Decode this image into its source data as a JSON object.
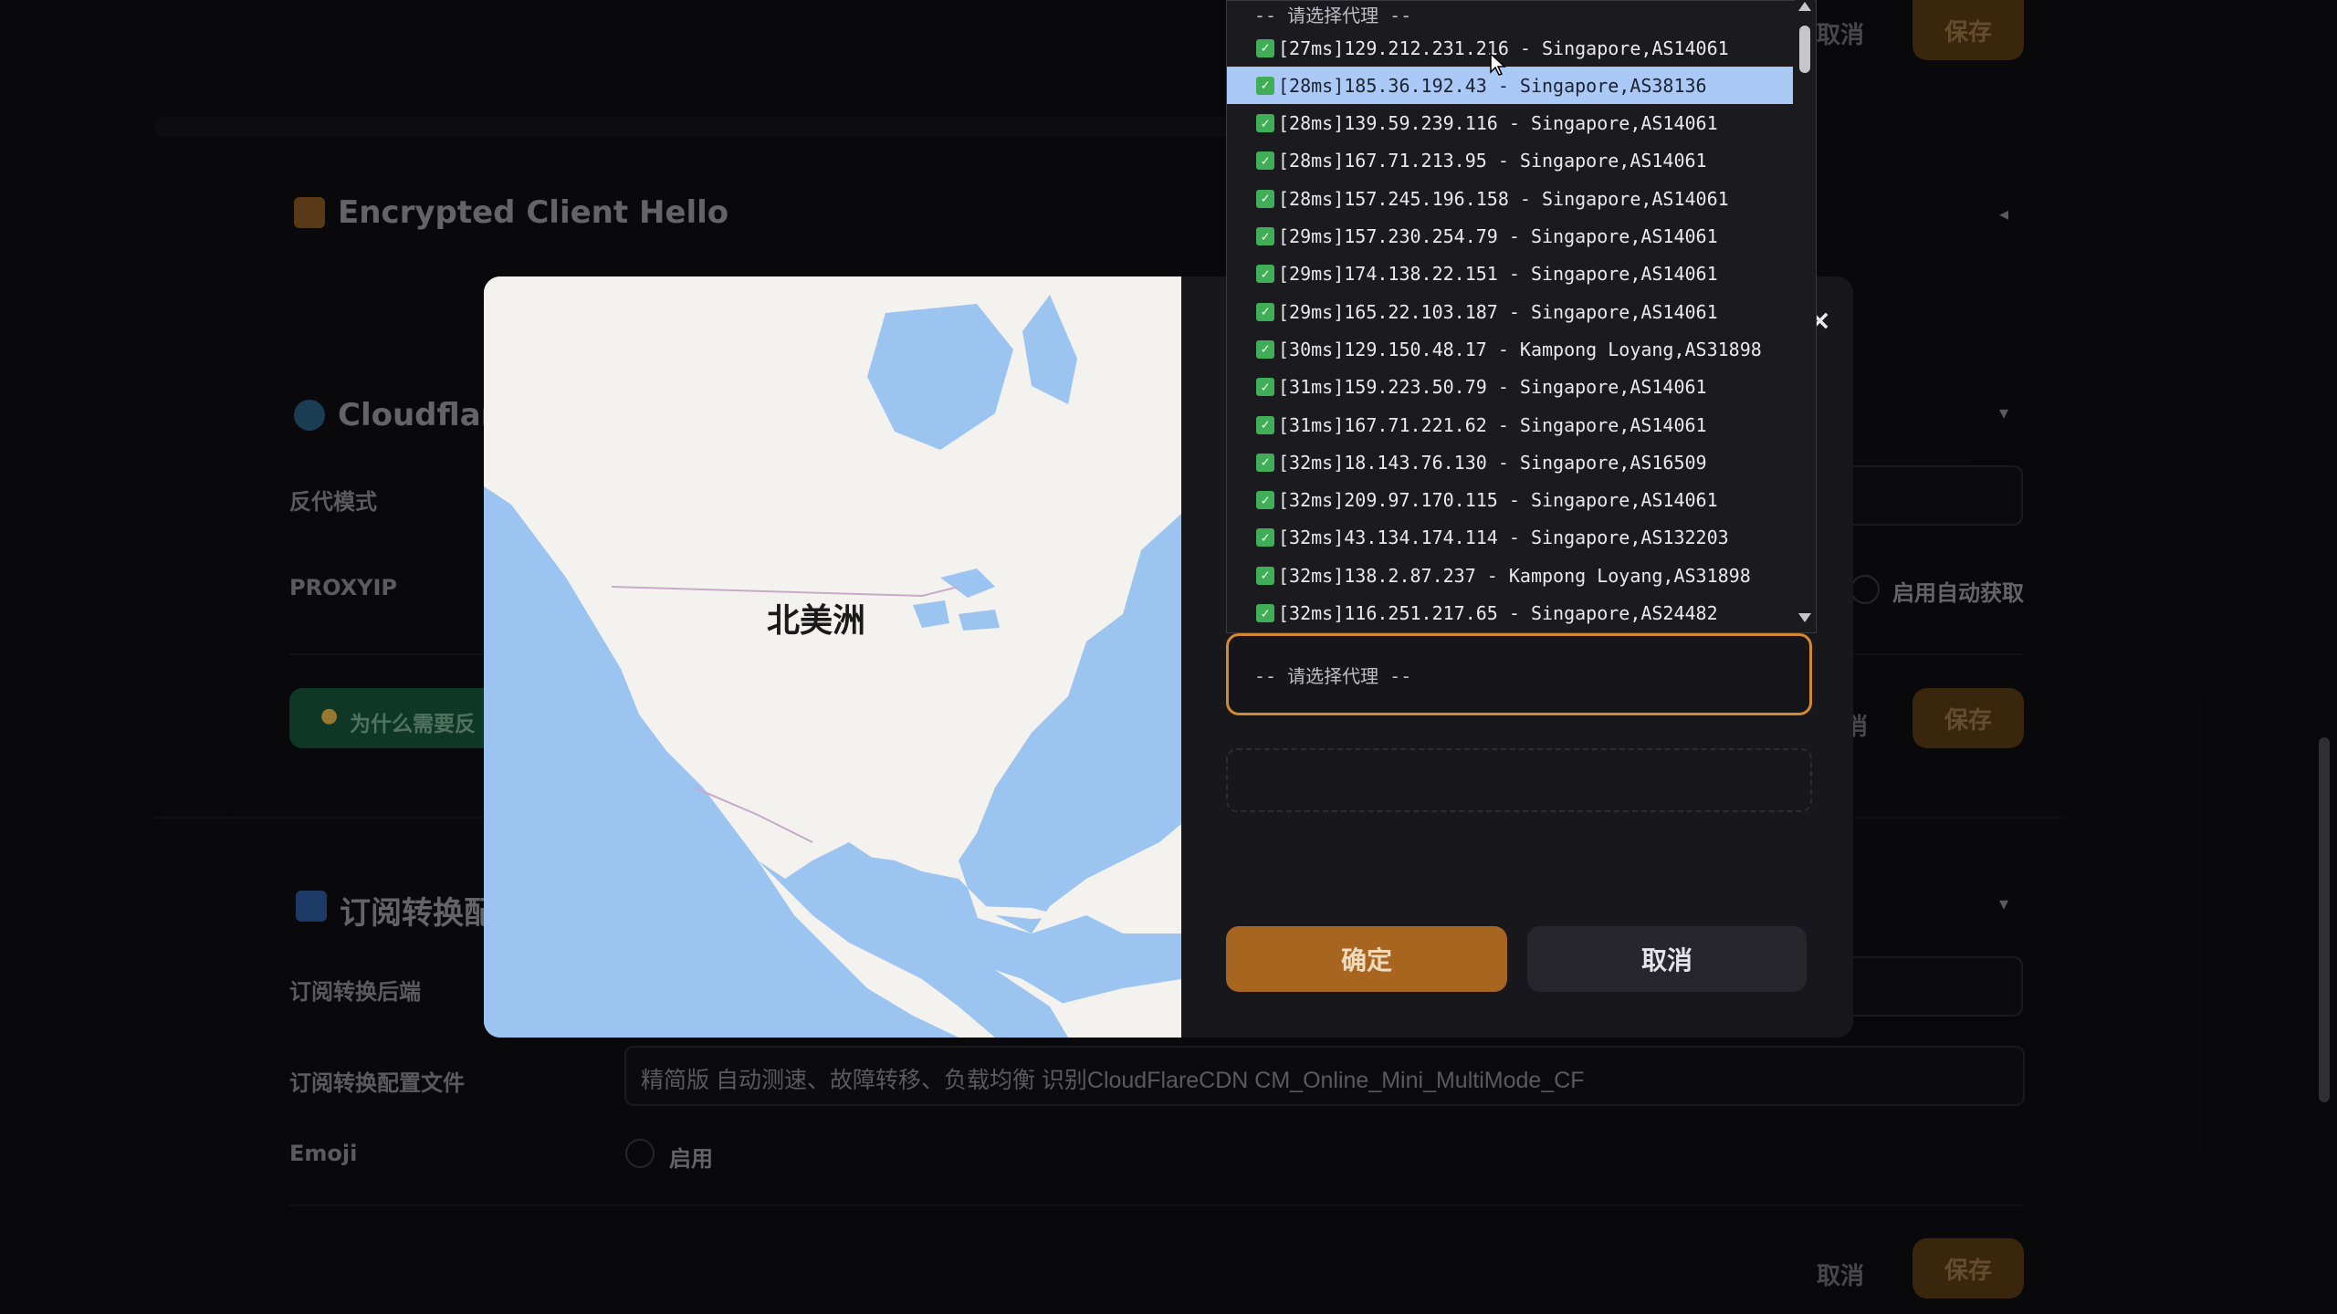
{
  "background": {
    "ech_title": "Encrypted Client Hello",
    "cf_title": "Cloudflare",
    "reverse_mode_label": "反代模式",
    "proxyip_label": "PROXYIP",
    "auto_fetch_label": "启用自动获取",
    "why_button": "为什么需要反",
    "sub_title": "订阅转换配",
    "sub_backend_label": "订阅转换后端",
    "sub_config_label": "订阅转换配置文件",
    "sub_config_value": "精简版 自动测速、故障转移、负载均衡 识别CloudFlareCDN CM_Online_Mini_MultiMode_CF",
    "emoji_label": "Emoji",
    "emoji_enable": "启用",
    "cancel": "取消",
    "save": "保存"
  },
  "modal": {
    "map_region": "北美洲",
    "close": "×",
    "select_placeholder": "-- 请选择代理 --",
    "confirm": "确定",
    "cancel": "取消"
  },
  "dropdown": {
    "header": "-- 请选择代理 --",
    "selected_index": 1,
    "items": [
      "[27ms]129.212.231.216 - Singapore,AS14061",
      "[28ms]185.36.192.43 - Singapore,AS38136",
      "[28ms]139.59.239.116 - Singapore,AS14061",
      "[28ms]167.71.213.95 - Singapore,AS14061",
      "[28ms]157.245.196.158 - Singapore,AS14061",
      "[29ms]157.230.254.79 - Singapore,AS14061",
      "[29ms]174.138.22.151 - Singapore,AS14061",
      "[29ms]165.22.103.187 - Singapore,AS14061",
      "[30ms]129.150.48.17 - Kampong Loyang,AS31898",
      "[31ms]159.223.50.79 - Singapore,AS14061",
      "[31ms]167.71.221.62 - Singapore,AS14061",
      "[32ms]18.143.76.130 - Singapore,AS16509",
      "[32ms]209.97.170.115 - Singapore,AS14061",
      "[32ms]43.134.174.114 - Singapore,AS132203",
      "[32ms]138.2.87.237 - Kampong Loyang,AS31898",
      "[32ms]116.251.217.65 - Singapore,AS24482"
    ]
  },
  "colors": {
    "accent": "#a86520",
    "select_border": "#d38a2e",
    "selected_row": "#aac9f7",
    "check": "#3fae56",
    "map_water": "#9cc4f0",
    "map_land": "#f3f2ee"
  }
}
